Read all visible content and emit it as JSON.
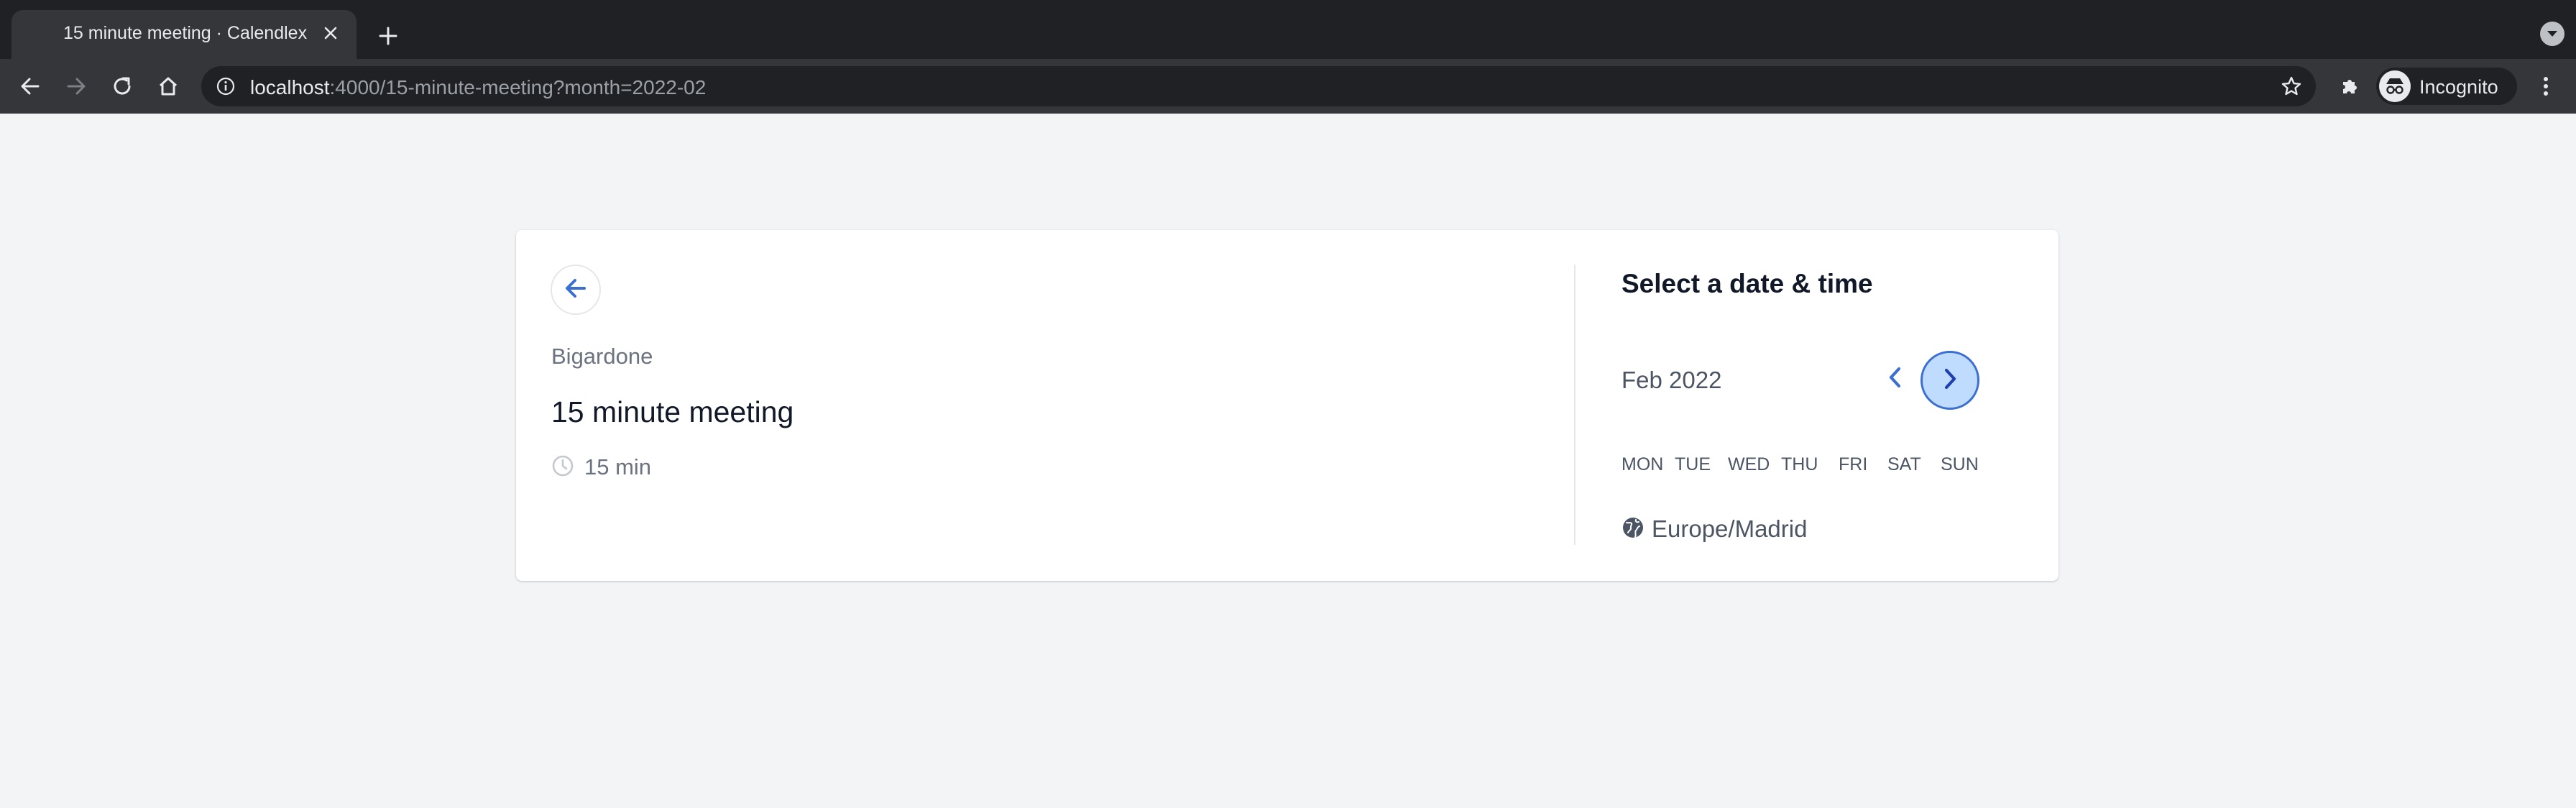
{
  "browser": {
    "tab_title": "15 minute meeting · Calendlex",
    "url_host": "localhost",
    "url_rest": ":4000/15-minute-meeting?month=2022-02",
    "profile_label": "Incognito"
  },
  "event": {
    "organizer": "Bigardone",
    "title": "15 minute meeting",
    "duration": "15 min"
  },
  "scheduler": {
    "title": "Select a date & time",
    "month": "Feb 2022",
    "weekdays": [
      "MON",
      "TUE",
      "WED",
      "THU",
      "FRI",
      "SAT",
      "SUN"
    ],
    "timezone": "Europe/Madrid"
  },
  "colors": {
    "accent": "#3b6fd1",
    "accent_light": "#bfdbfe",
    "page_bg": "#f3f4f6"
  },
  "icons": {
    "back": "arrow-left-icon",
    "clock": "clock-icon",
    "prev": "chevron-left-icon",
    "next": "chevron-right-icon",
    "timezone": "globe-icon"
  }
}
